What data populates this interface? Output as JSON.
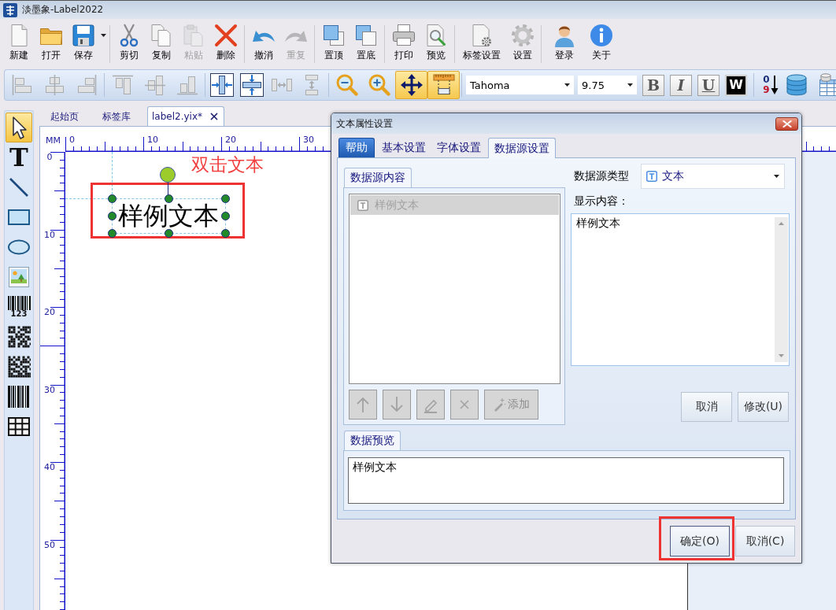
{
  "window": {
    "title": "淡墨象-Label2022"
  },
  "toolbar": {
    "groups": [
      [
        {
          "label": "新建",
          "disabled": false,
          "menu": false
        },
        {
          "label": "打开",
          "disabled": false,
          "menu": false
        },
        {
          "label": "保存",
          "disabled": false,
          "menu": true
        }
      ],
      [
        {
          "label": "剪切",
          "disabled": false,
          "menu": false
        },
        {
          "label": "复制",
          "disabled": false,
          "menu": false
        },
        {
          "label": "粘贴",
          "disabled": true,
          "menu": false
        },
        {
          "label": "删除",
          "disabled": false,
          "menu": false
        }
      ],
      [
        {
          "label": "撤消",
          "disabled": false,
          "menu": false
        },
        {
          "label": "重复",
          "disabled": true,
          "menu": false
        }
      ],
      [
        {
          "label": "置顶",
          "disabled": false,
          "menu": false
        },
        {
          "label": "置底",
          "disabled": false,
          "menu": false
        }
      ],
      [
        {
          "label": "打印",
          "disabled": false,
          "menu": false
        },
        {
          "label": "预览",
          "disabled": false,
          "menu": false
        }
      ],
      [
        {
          "label": "标签设置",
          "disabled": false,
          "menu": false
        },
        {
          "label": "设置",
          "disabled": false,
          "menu": false
        }
      ],
      [
        {
          "label": "登录",
          "disabled": false,
          "menu": false
        },
        {
          "label": "关于",
          "disabled": false,
          "menu": false
        }
      ]
    ]
  },
  "format_bar": {
    "groups": [
      [
        {
          "disabled": true,
          "on": false
        },
        {
          "disabled": true,
          "on": false
        },
        {
          "disabled": true,
          "on": false
        }
      ],
      [
        {
          "disabled": true,
          "on": false
        },
        {
          "disabled": true,
          "on": false
        },
        {
          "disabled": true,
          "on": false
        }
      ],
      [
        {
          "disabled": false,
          "on": false
        },
        {
          "disabled": false,
          "on": false
        },
        {
          "disabled": true,
          "on": false
        },
        {
          "disabled": true,
          "on": false
        }
      ],
      [
        {
          "disabled": false,
          "on": false
        },
        {
          "disabled": false,
          "on": false
        },
        {
          "disabled": false,
          "on": true
        },
        {
          "disabled": false,
          "on": true
        }
      ]
    ],
    "font": {
      "value": "Tahoma"
    },
    "size": {
      "value": "9.75"
    },
    "styles": [
      {
        "label": "B",
        "kind": "bold"
      },
      {
        "label": "I",
        "kind": "italic"
      },
      {
        "label": "U",
        "kind": "underline"
      },
      {
        "label": "W",
        "kind": "inverse"
      }
    ],
    "sort_digits": [
      "0",
      "9"
    ]
  },
  "tools": [
    {
      "selected": true
    },
    {
      "selected": false,
      "glyph": "T"
    },
    {
      "selected": false
    },
    {
      "selected": false
    },
    {
      "selected": false
    },
    {
      "selected": false
    },
    {
      "selected": false,
      "caption": "123"
    },
    {
      "selected": false
    },
    {
      "selected": false
    },
    {
      "selected": false
    },
    {
      "selected": false
    }
  ],
  "doc_tabs": [
    {
      "label": "起始页",
      "selected": false,
      "closable": false
    },
    {
      "label": "标签库",
      "selected": false,
      "closable": false
    },
    {
      "label": "label2.yix*",
      "selected": true,
      "closable": true
    }
  ],
  "canvas": {
    "ruler": {
      "unit": "MM",
      "top_labels": [
        "0",
        "10",
        "20",
        "30"
      ],
      "left_labels": [
        "0",
        "10",
        "20",
        "30",
        "40",
        "50"
      ]
    },
    "element": {
      "text": "样例文本",
      "selected": true,
      "highlighted": true
    },
    "annotation": "双击文本"
  },
  "dialog": {
    "title": "文本属性设置",
    "help_button": "帮助",
    "tabs": [
      {
        "label": "基本设置",
        "selected": false
      },
      {
        "label": "字体设置",
        "selected": false
      },
      {
        "label": "数据源设置",
        "selected": true
      }
    ],
    "source_group": {
      "title": "数据源内容",
      "items": [
        {
          "text": "样例文本",
          "selected": true
        }
      ],
      "buttons": [
        {
          "kind": "up",
          "disabled": true
        },
        {
          "kind": "down",
          "disabled": true
        },
        {
          "kind": "edit",
          "disabled": true
        },
        {
          "kind": "delete",
          "disabled": true
        },
        {
          "kind": "add",
          "label": "添加",
          "disabled": true
        }
      ]
    },
    "source_type": {
      "label": "数据源类型",
      "value": "文本"
    },
    "display": {
      "label": "显示内容：",
      "value": "样例文本"
    },
    "edit_buttons": [
      {
        "label": "取消"
      },
      {
        "label": "修改(U)"
      }
    ],
    "preview": {
      "title": "数据预览",
      "value": "样例文本"
    },
    "buttons": [
      {
        "label": "确定(O)",
        "default": true,
        "highlighted": true
      },
      {
        "label": "取消(C)",
        "default": false,
        "highlighted": false
      }
    ]
  }
}
